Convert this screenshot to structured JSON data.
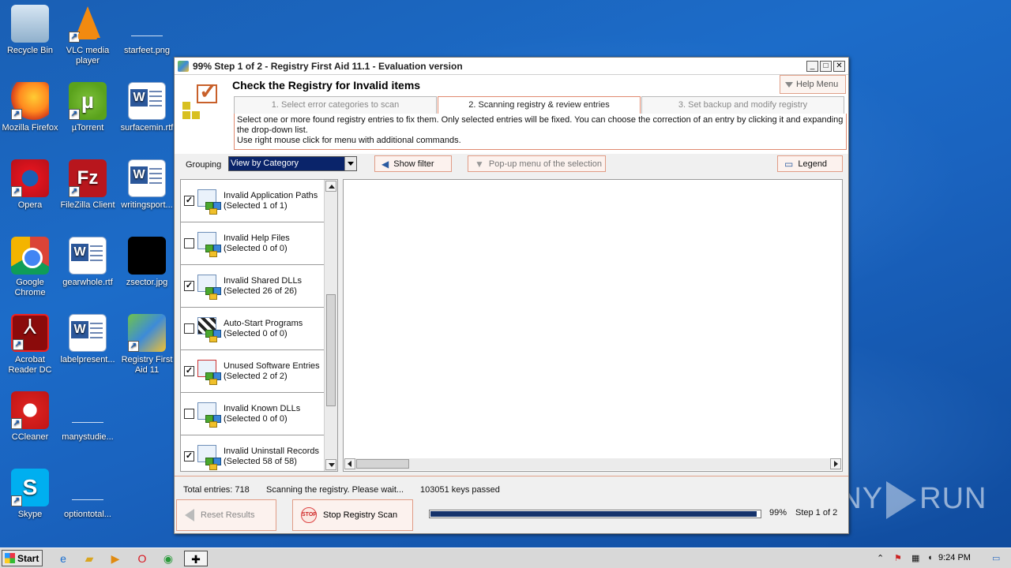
{
  "desktop": {
    "icons": [
      {
        "label": "Recycle Bin",
        "icon": "recycle-bin-icon"
      },
      {
        "label": "VLC media player",
        "icon": "vlc-icon"
      },
      {
        "label": "starfeet.png",
        "icon": "image-file-icon"
      },
      {
        "label": "Mozilla Firefox",
        "icon": "firefox-icon"
      },
      {
        "label": "µTorrent",
        "icon": "utorrent-icon"
      },
      {
        "label": "surfacemin.rtf",
        "icon": "word-doc-icon"
      },
      {
        "label": "Opera",
        "icon": "opera-icon"
      },
      {
        "label": "FileZilla Client",
        "icon": "filezilla-icon"
      },
      {
        "label": "writingsport...",
        "icon": "word-doc-icon"
      },
      {
        "label": "Google Chrome",
        "icon": "chrome-icon"
      },
      {
        "label": "gearwhole.rtf",
        "icon": "word-doc-icon"
      },
      {
        "label": "zsector.jpg",
        "icon": "image-file-icon"
      },
      {
        "label": "Acrobat Reader DC",
        "icon": "acrobat-icon"
      },
      {
        "label": "labelpresent...",
        "icon": "word-doc-icon"
      },
      {
        "label": "Registry First Aid 11",
        "icon": "registry-first-aid-icon"
      },
      {
        "label": "CCleaner",
        "icon": "ccleaner-icon"
      },
      {
        "label": "manystudie...",
        "icon": "file-icon"
      },
      {
        "label": "Skype",
        "icon": "skype-icon"
      },
      {
        "label": "optiontotal...",
        "icon": "file-icon"
      }
    ]
  },
  "window": {
    "title": "99% Step 1 of 2 - Registry First Aid 11.1 - Evaluation version",
    "controls": {
      "minimize": "_",
      "maximize": "□",
      "close": "✕"
    },
    "header_title": "Check the Registry for Invalid items",
    "help_label": "Help Menu",
    "tabs": [
      {
        "label": "1. Select error categories to scan",
        "active": false
      },
      {
        "label": "2. Scanning registry & review entries",
        "active": true
      },
      {
        "label": "3. Set backup and modify registry",
        "active": false
      }
    ],
    "info_line1": "Select one or more found registry entries to fix them. Only selected entries will be fixed. You can choose the correction of an entry by clicking it and expanding the drop-down list.",
    "info_line2": "Use right mouse click for menu with additional commands.",
    "grouping_label": "Grouping",
    "grouping_value": "View by Category",
    "show_filter_label": "Show filter",
    "popup_menu_label": "Pop-up menu of the selection",
    "legend_label": "Legend",
    "categories": [
      {
        "name": "Invalid Application Paths",
        "selected": "(Selected 1 of 1)",
        "checked": true
      },
      {
        "name": "Invalid Help Files",
        "selected": "(Selected 0 of 0)",
        "checked": false
      },
      {
        "name": "Invalid Shared DLLs",
        "selected": "(Selected 26 of 26)",
        "checked": true
      },
      {
        "name": "Auto-Start Programs",
        "selected": "(Selected 0 of 0)",
        "checked": false
      },
      {
        "name": "Unused Software Entries",
        "selected": "(Selected 2 of 2)",
        "checked": true
      },
      {
        "name": "Invalid Known DLLs",
        "selected": "(Selected 0 of 0)",
        "checked": false
      },
      {
        "name": "Invalid Uninstall Records",
        "selected": "(Selected 58 of 58)",
        "checked": true
      }
    ],
    "status": {
      "total": "Total entries: 718",
      "scanning": "Scanning the registry. Please wait...",
      "keys": "103051 keys passed"
    },
    "reset_label": "Reset Results",
    "stop_label": "Stop Registry Scan",
    "stop_icon_text": "STOP",
    "progress_percent": 99,
    "progress_text": "99%",
    "step_text": "Step 1 of 2"
  },
  "taskbar": {
    "start_label": "Start",
    "clock": "9:24 PM",
    "apps": [
      "ie-icon",
      "explorer-icon",
      "media-player-icon",
      "opera-icon",
      "chrome-icon",
      "registry-first-aid-icon"
    ]
  },
  "watermark": {
    "left": "ANY",
    "right": "RUN"
  }
}
